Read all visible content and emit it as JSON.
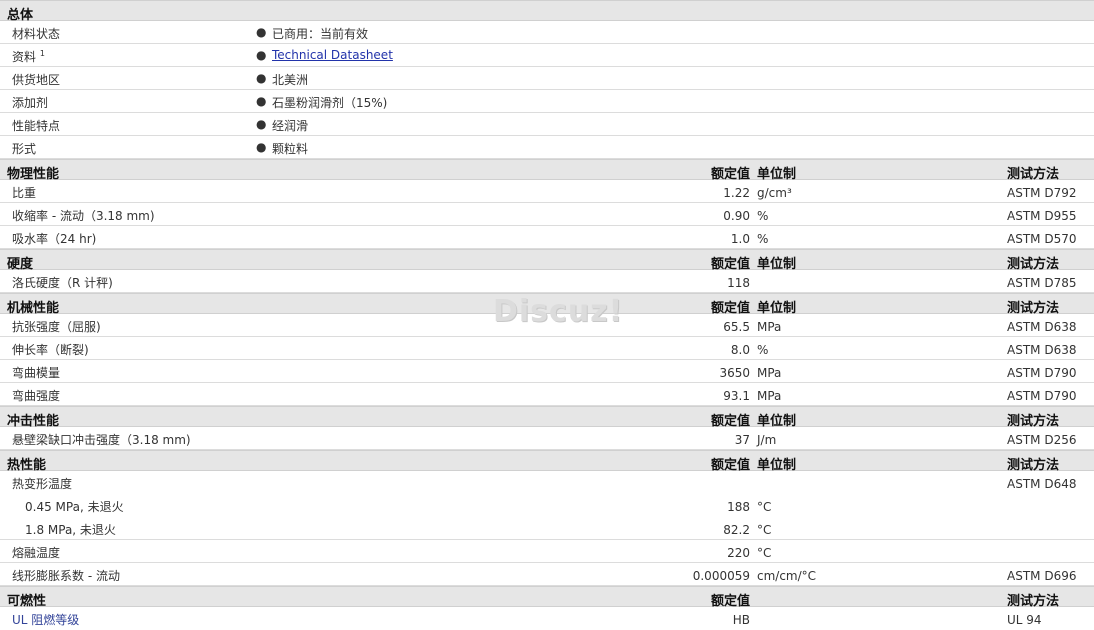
{
  "general": {
    "title": "总体",
    "rows": [
      {
        "label": "材料状态",
        "value": "已商用：当前有效"
      },
      {
        "label": "资料",
        "sup": "1",
        "value": "Technical Datasheet"
      },
      {
        "label": "供货地区",
        "value": "北美洲"
      },
      {
        "label": "添加剂",
        "value": "石墨粉润滑剂（15%)"
      },
      {
        "label": "性能特点",
        "value": "经润滑"
      },
      {
        "label": "形式",
        "value": "颗粒料"
      }
    ]
  },
  "headers": {
    "nominal": "额定值",
    "unit": "单位制",
    "method": "测试方法"
  },
  "physical": {
    "title": "物理性能",
    "rows": [
      {
        "label": "比重",
        "value": "1.22",
        "unit": "g/cm³",
        "method": "ASTM D792"
      },
      {
        "label": "收缩率 - 流动（3.18 mm)",
        "value": "0.90",
        "unit": "%",
        "method": "ASTM D955"
      },
      {
        "label": "吸水率（24 hr)",
        "value": "1.0",
        "unit": "%",
        "method": "ASTM D570"
      }
    ]
  },
  "hardness": {
    "title": "硬度",
    "rows": [
      {
        "label": "洛氏硬度（R 计秤)",
        "value": "118",
        "unit": "",
        "method": "ASTM D785"
      }
    ]
  },
  "mechanical": {
    "title": "机械性能",
    "rows": [
      {
        "label": "抗张强度（屈服)",
        "value": "65.5",
        "unit": "MPa",
        "method": "ASTM D638"
      },
      {
        "label": "伸长率（断裂)",
        "value": "8.0",
        "unit": "%",
        "method": "ASTM D638"
      },
      {
        "label": "弯曲模量",
        "value": "3650",
        "unit": "MPa",
        "method": "ASTM D790"
      },
      {
        "label": "弯曲强度",
        "value": "93.1",
        "unit": "MPa",
        "method": "ASTM D790"
      }
    ]
  },
  "impact": {
    "title": "冲击性能",
    "rows": [
      {
        "label": "悬壁梁缺口冲击强度（3.18 mm)",
        "value": "37",
        "unit": "J/m",
        "method": "ASTM D256"
      }
    ]
  },
  "thermal": {
    "title": "热性能",
    "rows": [
      {
        "label": "热变形温度",
        "value": "",
        "unit": "",
        "method": "ASTM D648"
      },
      {
        "label": "0.45 MPa, 未退火",
        "value": "188",
        "unit": "°C",
        "method": ""
      },
      {
        "label": "1.8 MPa, 未退火",
        "value": "82.2",
        "unit": "°C",
        "method": ""
      },
      {
        "label": "熔融温度",
        "value": "220",
        "unit": "°C",
        "method": ""
      },
      {
        "label": "线形膨胀系数 - 流动",
        "value": "0.000059",
        "unit": "cm/cm/°C",
        "method": "ASTM D696"
      }
    ]
  },
  "flammability": {
    "title": "可燃性",
    "rows": [
      {
        "label": "UL 阻燃等级",
        "value": "HB",
        "unit": "",
        "method": "UL 94"
      }
    ]
  },
  "watermark": "Discuz!"
}
